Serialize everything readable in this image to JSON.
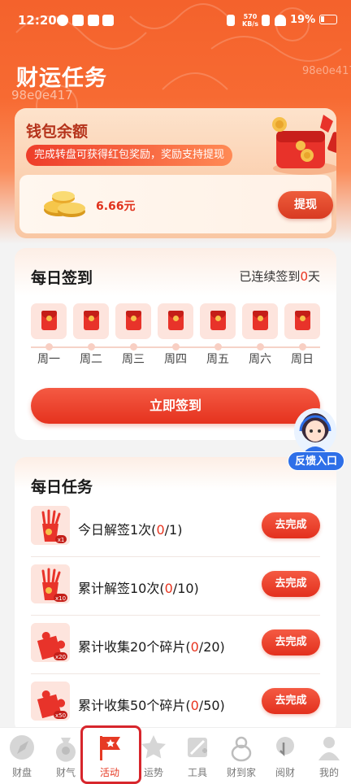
{
  "status_bar": {
    "time": "12:20",
    "net_speed": "570",
    "net_unit": "KB/s",
    "battery": "19%"
  },
  "header": {
    "title": "财运任务",
    "watermark_left": "98e0e417",
    "watermark_right": "98e0e417"
  },
  "wallet": {
    "title": "钱包余额",
    "tip": "完成转盘可获得红包奖励，奖励支持提现",
    "amount": "6.66元",
    "withdraw_label": "提现"
  },
  "checkin": {
    "title": "每日签到",
    "streak_prefix": "已连续签到",
    "streak_days": "0",
    "streak_suffix": "天",
    "days": [
      "周一",
      "周二",
      "周三",
      "周四",
      "周五",
      "周六",
      "周日"
    ],
    "button_label": "立即签到"
  },
  "feedback": {
    "label": "反馈入口"
  },
  "tasks": {
    "title": "每日任务",
    "items": [
      {
        "name": "今日解签1次(",
        "progress": "0",
        "total": "/1)",
        "badge": "x1",
        "action": "去完成"
      },
      {
        "name": "累计解签10次(",
        "progress": "0",
        "total": "/10)",
        "badge": "x10",
        "action": "去完成"
      },
      {
        "name": "累计收集20个碎片(",
        "progress": "0",
        "total": "/20)",
        "badge": "x20",
        "action": "去完成"
      },
      {
        "name": "累计收集50个碎片(",
        "progress": "0",
        "total": "/50)",
        "badge": "x50",
        "action": "去完成"
      }
    ]
  },
  "tabbar": {
    "items": [
      {
        "label": "财盘",
        "icon": "compass-icon"
      },
      {
        "label": "财气",
        "icon": "money-bag-icon"
      },
      {
        "label": "活动",
        "icon": "flag-icon",
        "active": true
      },
      {
        "label": "运势",
        "icon": "star-icon"
      },
      {
        "label": "工具",
        "icon": "tools-icon"
      },
      {
        "label": "财到家",
        "icon": "gourd-icon"
      },
      {
        "label": "阅财",
        "icon": "reading-icon"
      },
      {
        "label": "我的",
        "icon": "person-icon"
      }
    ]
  },
  "colors": {
    "accent": "#e8341f",
    "header_orange": "#f4622c",
    "feedback_blue": "#2e6fe8"
  }
}
